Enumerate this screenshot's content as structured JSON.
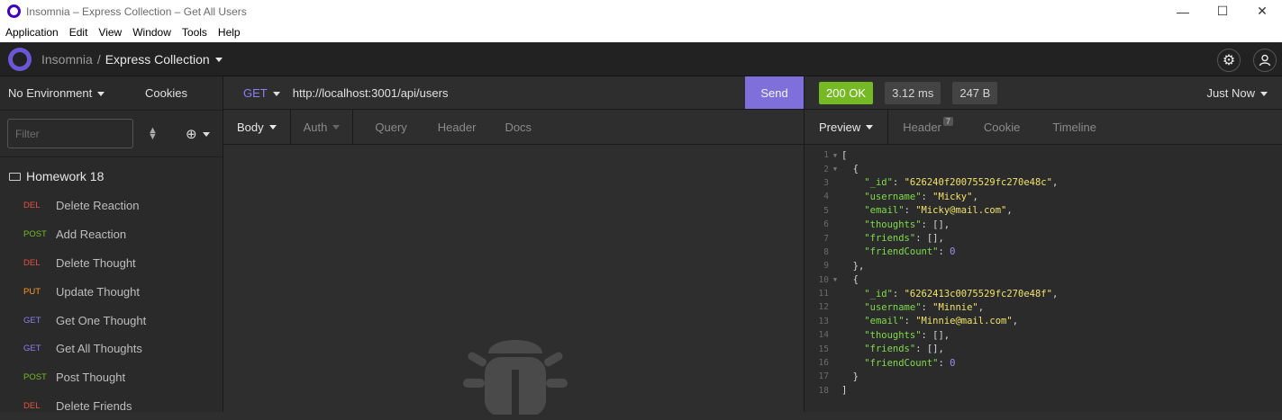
{
  "window": {
    "title": "Insomnia – Express Collection – Get All Users",
    "minimize": "—",
    "maximize": "☐",
    "close": "✕"
  },
  "menu": [
    "Application",
    "Edit",
    "View",
    "Window",
    "Tools",
    "Help"
  ],
  "breadcrumb": {
    "root": "Insomnia",
    "separator": "/",
    "current": "Express Collection"
  },
  "sidebar": {
    "environment": "No Environment",
    "cookies": "Cookies",
    "filter_placeholder": "Filter",
    "folder": "Homework 18",
    "items": [
      {
        "method": "DEL",
        "name": "Delete Reaction",
        "color": "#e8523f"
      },
      {
        "method": "POST",
        "name": "Add Reaction",
        "color": "#75ba24"
      },
      {
        "method": "DEL",
        "name": "Delete Thought",
        "color": "#e8523f"
      },
      {
        "method": "PUT",
        "name": "Update Thought",
        "color": "#ff9a1f"
      },
      {
        "method": "GET",
        "name": "Get One Thought",
        "color": "#8c7ff0"
      },
      {
        "method": "GET",
        "name": "Get All Thoughts",
        "color": "#8c7ff0"
      },
      {
        "method": "POST",
        "name": "Post Thought",
        "color": "#75ba24"
      },
      {
        "method": "DEL",
        "name": "Delete Friends",
        "color": "#e8523f"
      }
    ]
  },
  "request": {
    "method": "GET",
    "url": "http://localhost:3001/api/users",
    "send": "Send",
    "tabs": [
      "Body",
      "Auth",
      "Query",
      "Header",
      "Docs"
    ]
  },
  "response": {
    "status": "200 OK",
    "time": "3.12 ms",
    "size": "247 B",
    "when": "Just Now",
    "tabs": [
      "Preview",
      "Header",
      "Cookie",
      "Timeline"
    ],
    "header_count": "7",
    "lines": [
      "[",
      "  {",
      "    \"_id\": \"626240f20075529fc270e48c\",",
      "    \"username\": \"Micky\",",
      "    \"email\": \"Micky@mail.com\",",
      "    \"thoughts\": [],",
      "    \"friends\": [],",
      "    \"friendCount\": 0",
      "  },",
      "  {",
      "    \"_id\": \"6262413c0075529fc270e48f\",",
      "    \"username\": \"Minnie\",",
      "    \"email\": \"Minnie@mail.com\",",
      "    \"thoughts\": [],",
      "    \"friends\": [],",
      "    \"friendCount\": 0",
      "  }",
      "]"
    ]
  },
  "colors": {
    "accent": "#7f6fdb",
    "ok": "#75ba24"
  }
}
